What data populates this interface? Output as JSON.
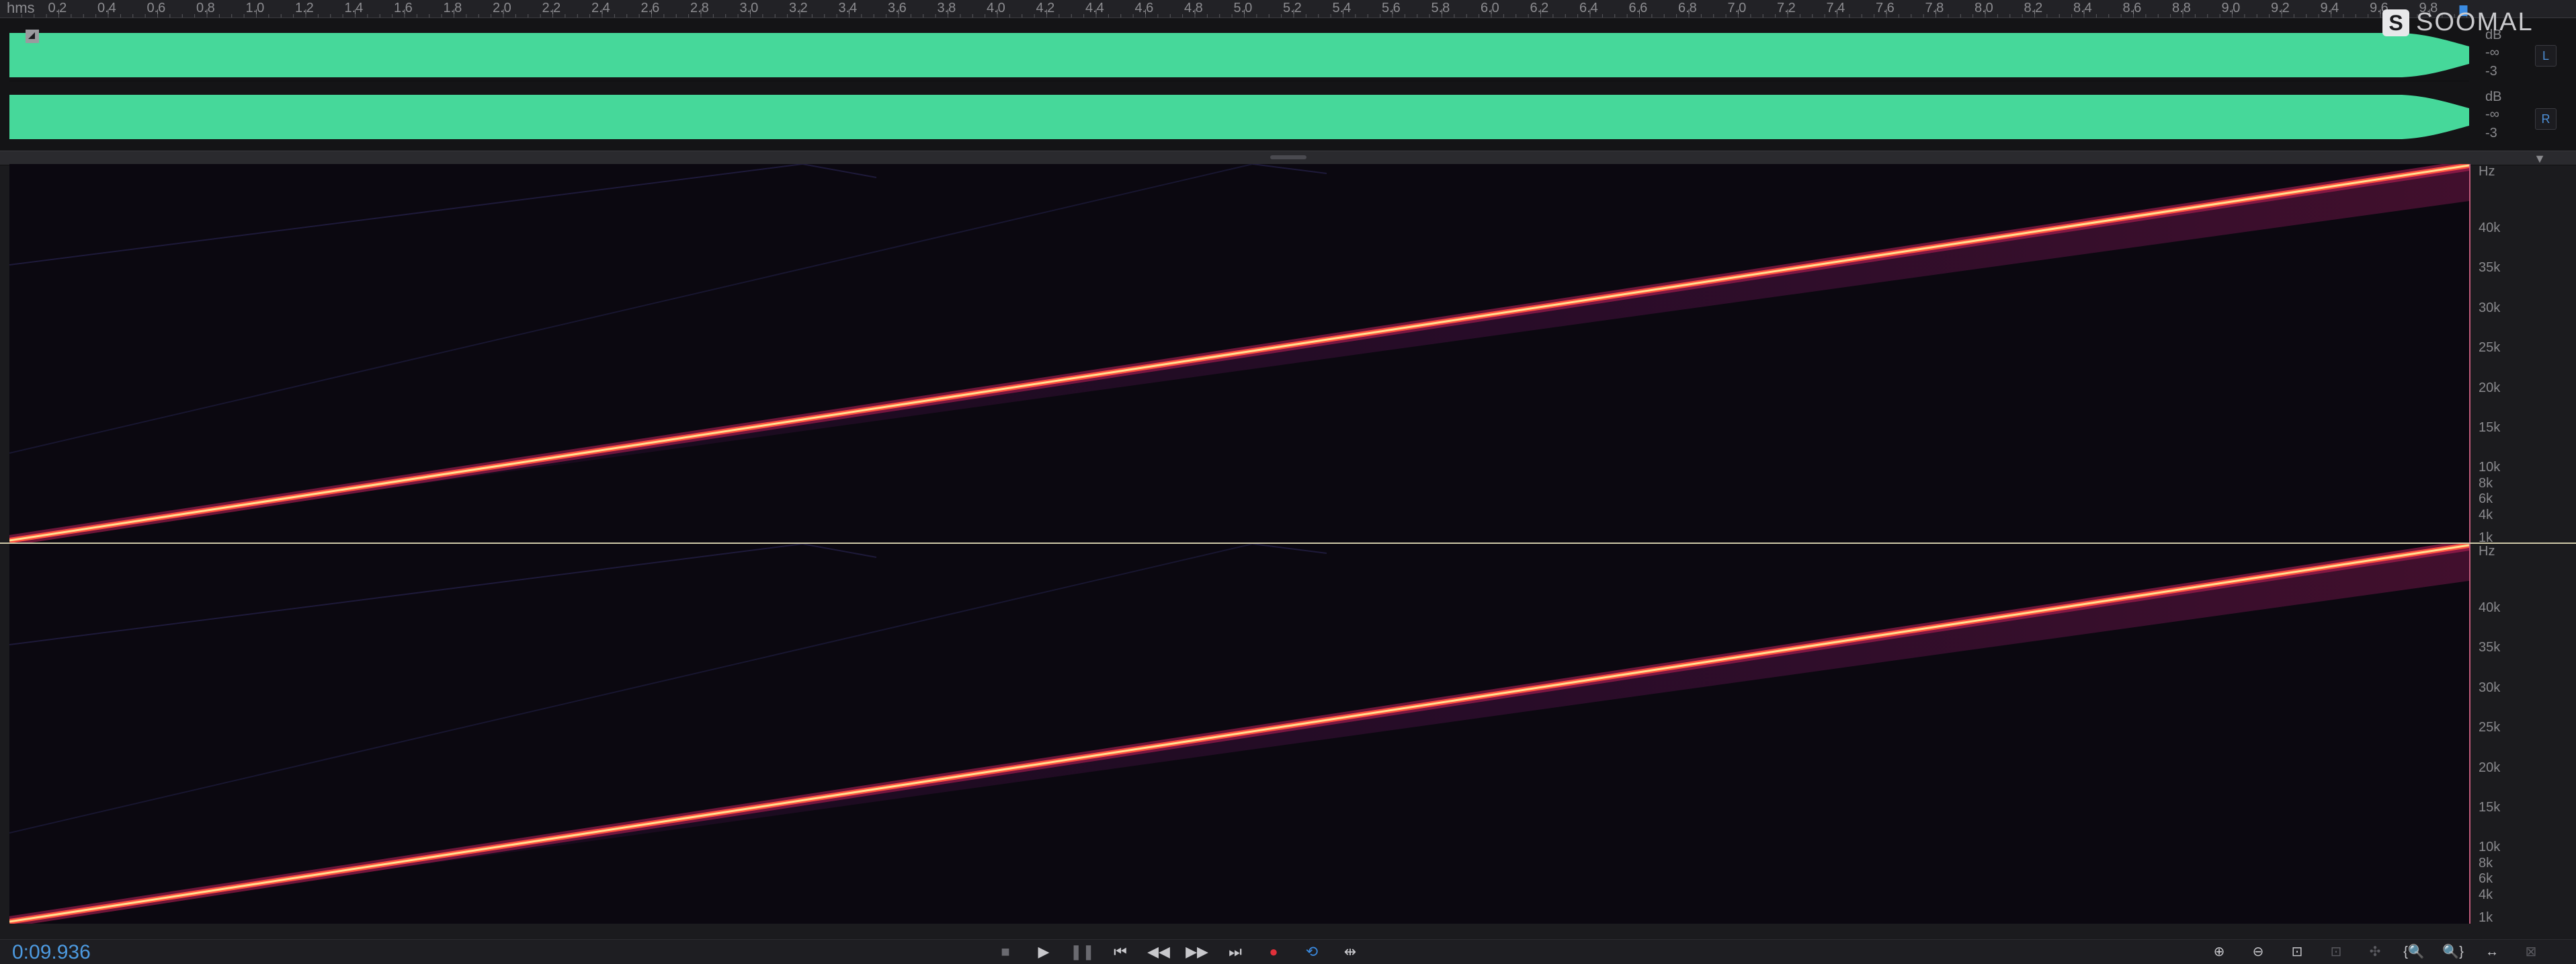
{
  "ruler": {
    "unit": "hms",
    "labels": [
      "0.2",
      "0.4",
      "0.6",
      "0.8",
      "1.0",
      "1.2",
      "1.4",
      "1.6",
      "1.8",
      "2.0",
      "2.2",
      "2.4",
      "2.6",
      "2.8",
      "3.0",
      "3.2",
      "3.4",
      "3.6",
      "3.8",
      "4.0",
      "4.2",
      "4.4",
      "4.6",
      "4.8",
      "5.0",
      "5.2",
      "5.4",
      "5.6",
      "5.8",
      "6.0",
      "6.2",
      "6.4",
      "6.6",
      "6.8",
      "7.0",
      "7.2",
      "7.4",
      "7.6",
      "7.8",
      "8.0",
      "8.2",
      "8.4",
      "8.6",
      "8.8",
      "9.0",
      "9.2",
      "9.4",
      "9.6",
      "9.8"
    ],
    "total_seconds": 9.936
  },
  "waveform": {
    "color": "#46d89a",
    "channels": [
      {
        "button": "L",
        "scale": [
          "dB",
          "-∞",
          "-3"
        ]
      },
      {
        "button": "R",
        "scale": [
          "dB",
          "-∞",
          "-3"
        ]
      }
    ]
  },
  "spectrogram": {
    "colormap": "inferno",
    "channels": [
      {
        "freq_labels": [
          "Hz",
          "40k",
          "35k",
          "30k",
          "25k",
          "20k",
          "15k",
          "10k",
          "8k",
          "6k",
          "4k",
          "1k"
        ]
      },
      {
        "freq_labels": [
          "Hz",
          "40k",
          "35k",
          "30k",
          "25k",
          "20k",
          "15k",
          "10k",
          "8k",
          "6k",
          "4k",
          "1k"
        ]
      }
    ]
  },
  "transport": {
    "time": "0:09.936",
    "buttons": [
      {
        "name": "stop-button",
        "icon": "■"
      },
      {
        "name": "play-button",
        "icon": "▶"
      },
      {
        "name": "pause-button",
        "icon": "❚❚"
      },
      {
        "name": "go-to-start-button",
        "icon": "⏮"
      },
      {
        "name": "rewind-button",
        "icon": "◀◀"
      },
      {
        "name": "fast-forward-button",
        "icon": "▶▶"
      },
      {
        "name": "go-to-end-button",
        "icon": "⏭"
      },
      {
        "name": "record-button",
        "icon": "●"
      },
      {
        "name": "loop-button",
        "icon": "⟲"
      },
      {
        "name": "skip-selection-button",
        "icon": "⇹"
      }
    ],
    "zoom_buttons": [
      {
        "name": "zoom-in-amplitude-button",
        "icon": "⊕"
      },
      {
        "name": "zoom-out-amplitude-button",
        "icon": "⊖"
      },
      {
        "name": "zoom-to-selection-button",
        "icon": "⊡"
      },
      {
        "name": "zoom-selection-disabled-button",
        "icon": "⊡"
      },
      {
        "name": "zoom-playhead-button",
        "icon": "✣"
      },
      {
        "name": "zoom-in-left-button",
        "icon": "{🔍"
      },
      {
        "name": "zoom-in-right-button",
        "icon": "🔍}"
      },
      {
        "name": "zoom-full-button",
        "icon": "↔"
      },
      {
        "name": "zoom-reset-button",
        "icon": "⊠"
      }
    ]
  },
  "logo": {
    "letter": "S",
    "text": "SOOMAL"
  },
  "colors": {
    "time": "#4d9ae0",
    "record": "#e0303a",
    "loop": "#3a8ae0",
    "sweep": "#ffd070"
  }
}
